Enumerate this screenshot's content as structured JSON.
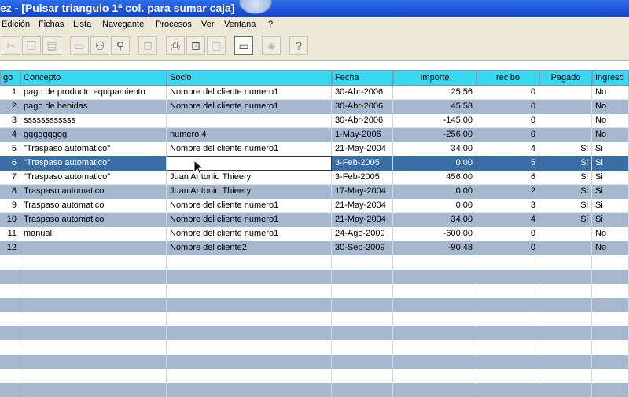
{
  "window": {
    "title": "ez - [Pulsar triangulo 1ª col. para sumar caja]"
  },
  "menu": [
    "Edición",
    "Fichas",
    "Lista",
    "Navegante",
    "Procesos",
    "Ver",
    "Ventana",
    "?"
  ],
  "toolbar": [
    "cut-icon",
    "copy-icon",
    "paste-icon",
    "window-icon",
    "binoculars-icon",
    "search-icon",
    "export-icon",
    "print-icon",
    "print-preview-icon",
    "page-icon",
    "display-icon",
    "tag-icon",
    "help-icon"
  ],
  "columns": [
    "go",
    "Concepto",
    "Socio",
    "Fecha",
    "Importe",
    "recibo",
    "Pagado",
    "Ingreso"
  ],
  "rows": [
    {
      "n": "1",
      "concepto": "pago de producto equipamiento",
      "socio": "Nombre del cliente numero1",
      "fecha": "30-Abr-2006",
      "importe": "25,56",
      "recibo": "0",
      "pagado": "",
      "ingreso": "No"
    },
    {
      "n": "2",
      "concepto": "pago de bebidas",
      "socio": "Nombre del cliente numero1",
      "fecha": "30-Abr-2006",
      "importe": "45,58",
      "recibo": "0",
      "pagado": "",
      "ingreso": "No"
    },
    {
      "n": "3",
      "concepto": "ssssssssssss",
      "socio": "",
      "fecha": "30-Abr-2006",
      "importe": "-145,00",
      "recibo": "0",
      "pagado": "",
      "ingreso": "No"
    },
    {
      "n": "4",
      "concepto": "ggggggggg",
      "socio": "numero 4",
      "fecha": "1-May-2006",
      "importe": "-256,00",
      "recibo": "0",
      "pagado": "",
      "ingreso": "No"
    },
    {
      "n": "5",
      "concepto": "\"Traspaso automatico\"",
      "socio": "Nombre del cliente numero1",
      "fecha": "21-May-2004",
      "importe": "34,00",
      "recibo": "4",
      "pagado": "Si",
      "ingreso": "Si"
    },
    {
      "n": "6",
      "concepto": "\"Traspaso automatico\"",
      "socio": "",
      "fecha": "3-Feb-2005",
      "importe": "0,00",
      "recibo": "5",
      "pagado": "Si",
      "ingreso": "Si"
    },
    {
      "n": "7",
      "concepto": "\"Traspaso automatico\"",
      "socio": "Juan Antonio  Thieery",
      "fecha": "3-Feb-2005",
      "importe": "456,00",
      "recibo": "6",
      "pagado": "Si",
      "ingreso": "Si"
    },
    {
      "n": "8",
      "concepto": "Traspaso automatico",
      "socio": "Juan Antonio  Thieery",
      "fecha": "17-May-2004",
      "importe": "0,00",
      "recibo": "2",
      "pagado": "Si",
      "ingreso": "Si"
    },
    {
      "n": "9",
      "concepto": "Traspaso automatico",
      "socio": "Nombre del cliente numero1",
      "fecha": "21-May-2004",
      "importe": "0,00",
      "recibo": "3",
      "pagado": "Si",
      "ingreso": "Si"
    },
    {
      "n": "10",
      "concepto": "Traspaso automatico",
      "socio": "Nombre del cliente numero1",
      "fecha": "21-May-2004",
      "importe": "34,00",
      "recibo": "4",
      "pagado": "Si",
      "ingreso": "Si"
    },
    {
      "n": "11",
      "concepto": "manual",
      "socio": "Nombre del cliente numero1",
      "fecha": "24-Ago-2009",
      "importe": "-600,00",
      "recibo": "0",
      "pagado": "",
      "ingreso": "No"
    },
    {
      "n": "12",
      "concepto": "",
      "socio": "Nombre del cliente2",
      "fecha": "30-Sep-2009",
      "importe": "-90,48",
      "recibo": "0",
      "pagado": "",
      "ingreso": "No"
    }
  ],
  "selected_row": "6",
  "colors": {
    "header": "#38d7ee",
    "alt_row": "#a5b8ce",
    "selection": "#3a6ea5",
    "titlebar": "#1a54d6"
  }
}
